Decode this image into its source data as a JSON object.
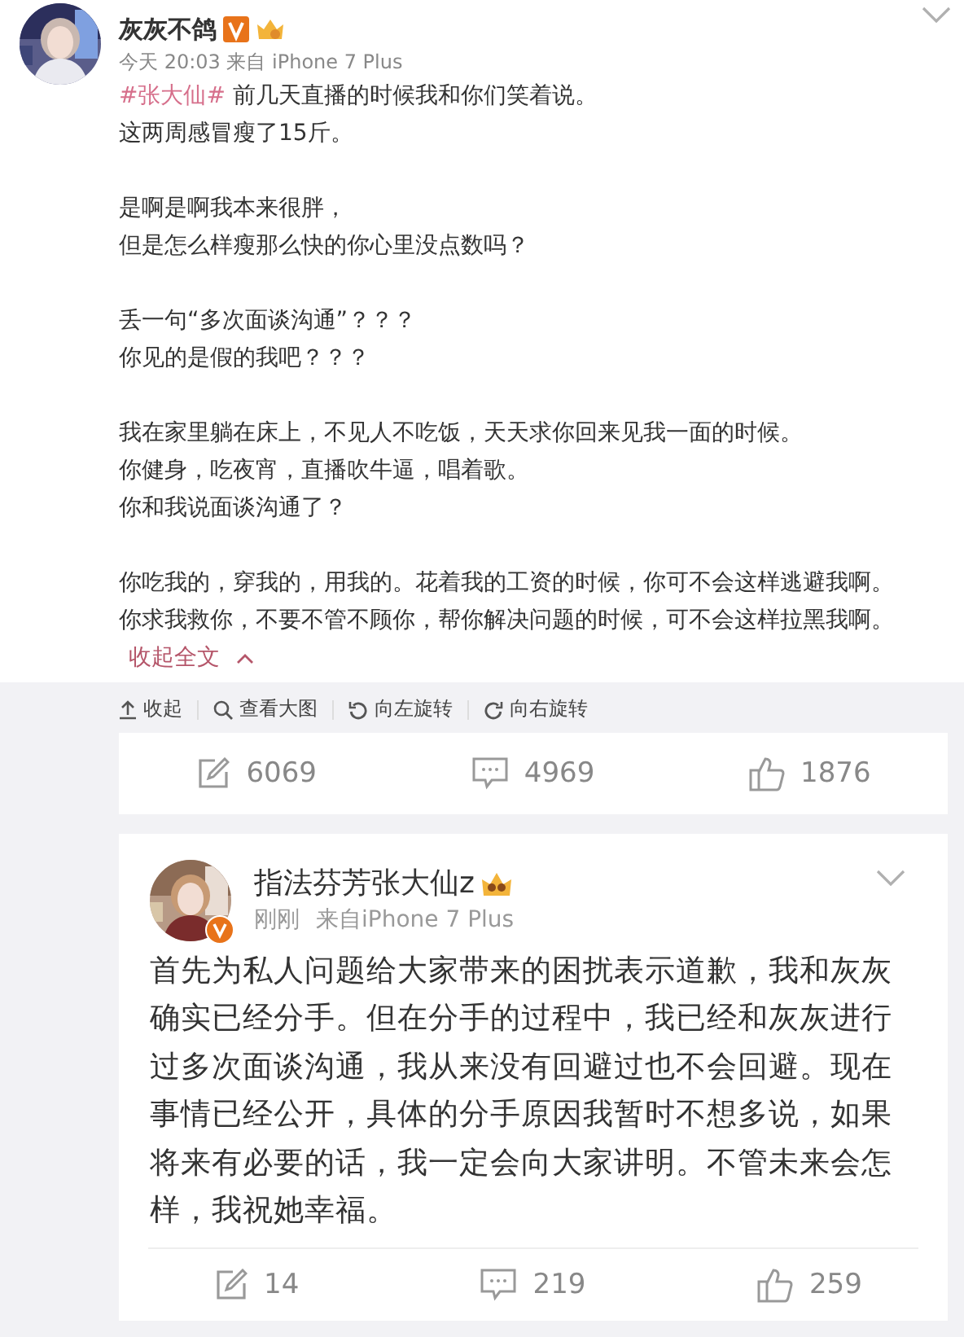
{
  "post": {
    "author": {
      "name": "灰灰不鸽"
    },
    "meta": "今天 20:03 来自 iPhone 7 Plus",
    "hashtag": "#张大仙#",
    "paragraphs": [
      [
        "前几天直播的时候我和你们笑着说。",
        "这两周感冒瘦了15斤。"
      ],
      [
        "是啊是啊我本来很胖，",
        "但是怎么样瘦那么快的你心里没点数吗？"
      ],
      [
        "丢一句“多次面谈沟通”？？？",
        "你见的是假的我吧？？？"
      ],
      [
        "我在家里躺在床上，不见人不吃饭，天天求你回来见我一面的时候。",
        "你健身，吃夜宵，直播吹牛逼，唱着歌。",
        "你和我说面谈沟通了？"
      ],
      [
        "你吃我的，穿我的，用我的。花着我的工资的时候，你可不会这样逃避我啊。",
        "你求我救你，不要不管不顾你，帮你解决问题的时候，可不会这样拉黑我啊。"
      ]
    ],
    "collapse_link": "收起全文",
    "toolbar": [
      {
        "kind": "collapse",
        "label": "收起"
      },
      {
        "kind": "zoom",
        "label": "查看大图"
      },
      {
        "kind": "rotate_left",
        "label": "向左旋转"
      },
      {
        "kind": "rotate_right",
        "label": "向右旋转"
      }
    ],
    "stats": [
      {
        "kind": "repost",
        "count": "6069"
      },
      {
        "kind": "comment",
        "count": "4969"
      },
      {
        "kind": "like",
        "count": "1876"
      }
    ]
  },
  "reply_post": {
    "author": {
      "name": "指法芬芳张大仙z"
    },
    "time": "刚刚",
    "source": "来自iPhone 7 Plus",
    "lines": [
      "首先为私人问题给大家带来的困扰表示道歉，我和灰灰",
      "确实已经分手。但在分手的过程中，我已经和灰灰进行",
      "过多次面谈沟通，我从来没有回避过也不会回避。现在",
      "事情已经公开，具体的分手原因我暂时不想多说，如果",
      "将来有必要的话，我一定会向大家讲明。不管未来会怎",
      "样，我祝她幸福。"
    ],
    "stats": [
      {
        "kind": "repost",
        "count": "14"
      },
      {
        "kind": "comment",
        "count": "219"
      },
      {
        "kind": "like",
        "count": "259"
      }
    ]
  }
}
